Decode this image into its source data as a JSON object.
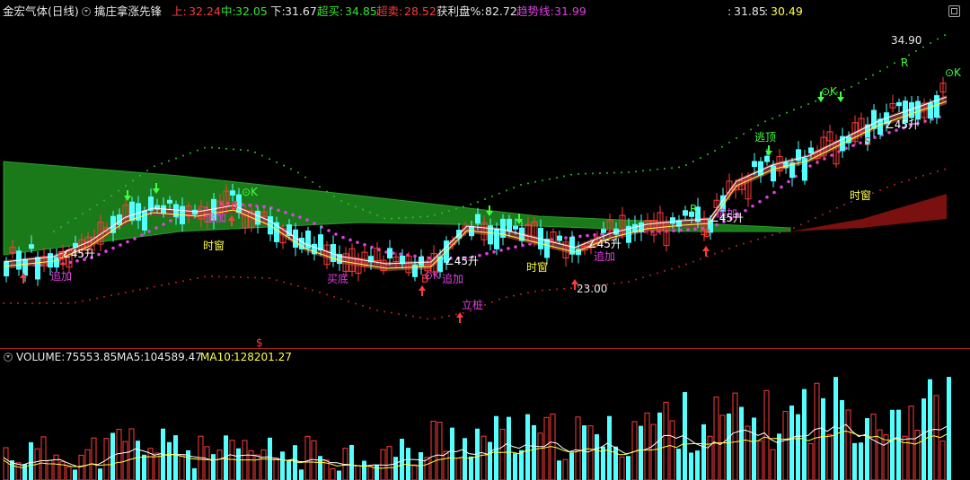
{
  "header": {
    "stock_name": "金宏气体",
    "period": "(日线)",
    "indicator_name": "擒庄拿涨先锋",
    "items": [
      {
        "label": "上:",
        "value": "32.24",
        "color": "#ff3b3b"
      },
      {
        "label": "中:",
        "value": "32.05",
        "color": "#32e632"
      },
      {
        "label": "下:",
        "value": "31.67",
        "color": "#e8e8e8"
      },
      {
        "label": "超买:",
        "value": "34.85",
        "color": "#32e632"
      },
      {
        "label": "超卖:",
        "value": "28.52",
        "color": "#ff3b3b"
      },
      {
        "label": "获利盘%:",
        "value": "82.72",
        "color": "#e8e8e8"
      },
      {
        "label": "趋势线:",
        "value": "31.99",
        "color": "#e040e0"
      }
    ],
    "right_values": [
      "31.85",
      "30.49"
    ],
    "colon": ":"
  },
  "main_chart": {
    "price_labels": {
      "high": "34.90",
      "low": "23.00"
    },
    "annotations": [
      {
        "text": "追加",
        "color": "#e040e0"
      },
      {
        "text": "追加",
        "color": "#e040e0"
      },
      {
        "text": "时窗",
        "color": "#ffff40"
      },
      {
        "text": "买底",
        "color": "#e040e0"
      },
      {
        "text": "追加",
        "color": "#e040e0"
      },
      {
        "text": "立桩",
        "color": "#e040e0"
      },
      {
        "text": "时窗",
        "color": "#ffff40"
      },
      {
        "text": "追加",
        "color": "#e040e0"
      },
      {
        "text": "追加",
        "color": "#e040e0"
      },
      {
        "text": "逃顶",
        "color": "#40ff40"
      },
      {
        "text": "时窗",
        "color": "#ffff40"
      },
      {
        "text": "∠45升",
        "color": "#ffffff"
      },
      {
        "text": "∠45升",
        "color": "#ffffff"
      },
      {
        "text": "∠45升",
        "color": "#ffffff"
      },
      {
        "text": "∠45升",
        "color": "#ffffff"
      },
      {
        "text": "∠45升",
        "color": "#ffffff"
      },
      {
        "text": "⊙K",
        "color": "#40ff40"
      },
      {
        "text": "⊙K",
        "color": "#40ff40"
      },
      {
        "text": "⊙K",
        "color": "#40ff40"
      },
      {
        "text": "⊙K",
        "color": "#e040e0"
      },
      {
        "text": "R",
        "color": "#40ff40"
      },
      {
        "text": "R",
        "color": "#40ff40"
      },
      {
        "text": "B",
        "color": "#ff3b3b"
      },
      {
        "text": "B",
        "color": "#ff3b3b"
      },
      {
        "text": "B",
        "color": "#ff3b3b"
      },
      {
        "text": "B",
        "color": "#ff3b3b"
      },
      {
        "text": "S",
        "color": "#ff3b3b"
      },
      {
        "text": "$",
        "color": "#ff3b3b"
      }
    ]
  },
  "volume": {
    "label": "VOLUME:",
    "value": "75553.85",
    "ma5_label": "MA5:",
    "ma5_value": "104589.47",
    "ma10_label": "MA10:",
    "ma10_value": "128201.27"
  },
  "colors": {
    "up": "#ff3b3b",
    "down": "#54ffff",
    "background": "#000000",
    "band_green": "#1a7a1a",
    "band_red": "#7a1010",
    "ma_white": "#ffffff",
    "ma_yellow": "#ffff40",
    "dots_magenta": "#e040e0",
    "dots_green": "#2bc02b",
    "dots_red": "#c02020"
  }
}
